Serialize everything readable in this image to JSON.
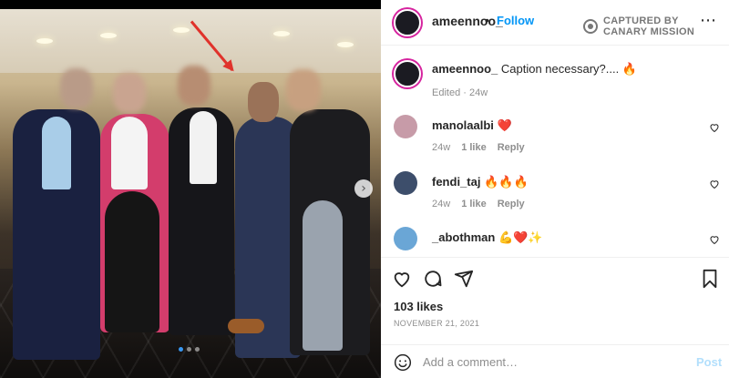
{
  "post": {
    "username": "ameennoo_",
    "bullet": "•",
    "follow_label": "Follow",
    "watermark": [
      "CAPTURED BY",
      "CANARY MISSION"
    ],
    "more_icon": "more-icon"
  },
  "caption": {
    "username": "ameennoo_",
    "text": " Caption necessary?.... 🔥",
    "meta": "Edited · 24w"
  },
  "comments": [
    {
      "username": "manolaalbi",
      "text": " ❤️",
      "time": "24w",
      "likes": "1 like",
      "reply": "Reply",
      "avatar_color": "#c79ba8"
    },
    {
      "username": "fendi_taj",
      "text": " 🔥🔥🔥",
      "time": "24w",
      "likes": "1 like",
      "reply": "Reply",
      "avatar_color": "#3d4e6b"
    },
    {
      "username": "_abothman",
      "text": " 💪❤️✨",
      "time": "",
      "likes": "",
      "reply": "",
      "avatar_color": "#6aa6d6"
    }
  ],
  "actions": {
    "likes": "103 likes",
    "date": "NOVEMBER 21, 2021"
  },
  "add_comment": {
    "placeholder": "Add a comment…",
    "post_label": "Post"
  },
  "colors": {
    "accent": "#0095f6",
    "story_ring": "#d6249f",
    "arrow": "#e0322b"
  }
}
